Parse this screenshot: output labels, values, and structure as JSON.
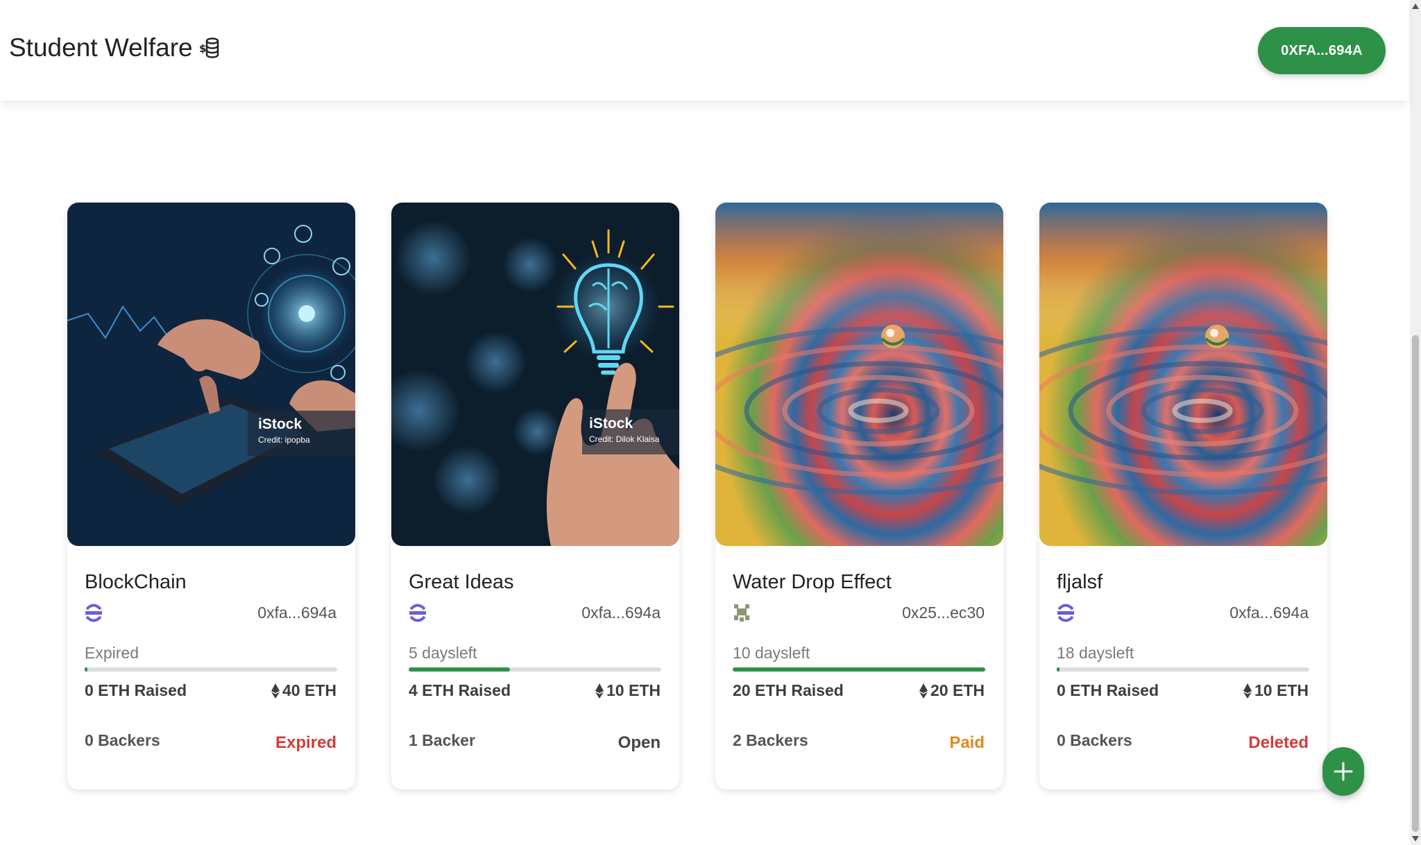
{
  "app": {
    "title": "Student Welfare",
    "brand_icon": "coin-stack-icon",
    "wallet_address": "0XFA...694A"
  },
  "campaigns": [
    {
      "title": "BlockChain",
      "image": "blockchain-hands-tablet-image",
      "image_watermark": "iStock",
      "image_credit": "Credit: ipopba",
      "owner_address": "0xfa...694a",
      "days_left": "Expired",
      "progress": 0.01,
      "raised": "0 ETH Raised",
      "target": "40 ETH",
      "backers": "0 Backers",
      "status": "Expired",
      "status_color": "#d63a3a"
    },
    {
      "title": "Great Ideas",
      "image": "lightbulb-brain-hand-image",
      "image_watermark": "iStock",
      "image_credit": "Credit: Dilok Klaisa",
      "owner_address": "0xfa...694a",
      "days_left": "5 daysleft",
      "progress": 0.4,
      "raised": "4 ETH Raised",
      "target": "10 ETH",
      "backers": "1 Backer",
      "status": "Open",
      "status_color": "#444444"
    },
    {
      "title": "Water Drop Effect",
      "image": "water-drop-ripple-image",
      "owner_address": "0x25...ec30",
      "days_left": "10 daysleft",
      "progress": 1,
      "raised": "20 ETH Raised",
      "target": "20 ETH",
      "backers": "2 Backers",
      "status": "Paid",
      "status_color": "#e08a1e"
    },
    {
      "title": "fljalsf",
      "image": "water-drop-ripple-image",
      "owner_address": "0xfa...694a",
      "days_left": "18 daysleft",
      "progress": 0.01,
      "raised": "0 ETH Raised",
      "target": "10 ETH",
      "backers": "0 Backers",
      "status": "Deleted",
      "status_color": "#d63a3a"
    }
  ],
  "theme": {
    "accent": "#2e9148"
  },
  "fab": {
    "icon": "plus-icon"
  }
}
